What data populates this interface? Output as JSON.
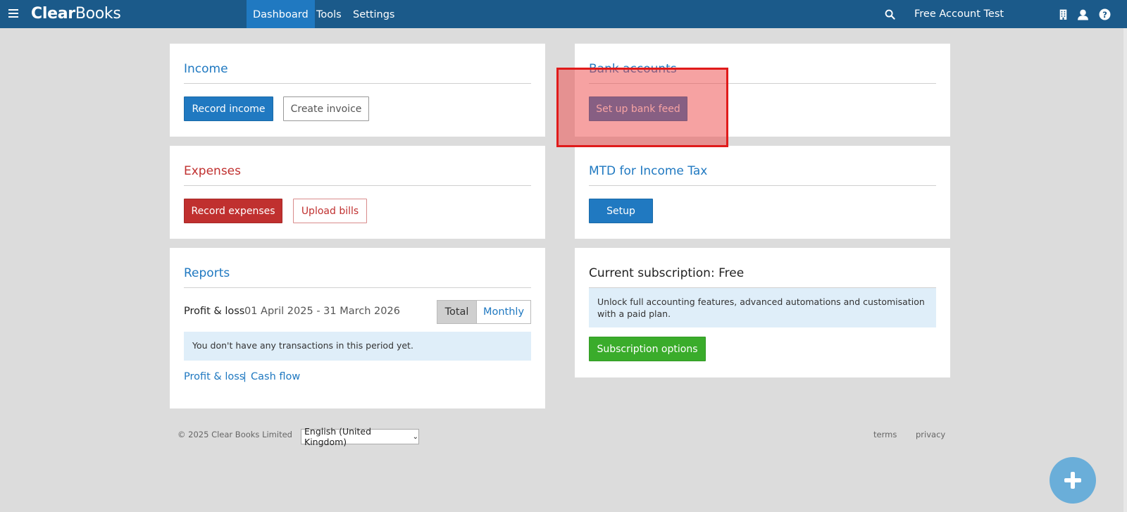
{
  "header": {
    "logo_part1": "Clear",
    "logo_part2": "Books",
    "nav": [
      {
        "label": "Dashboard",
        "active": true
      },
      {
        "label": "Tools",
        "active": false
      },
      {
        "label": "Settings",
        "active": false
      }
    ],
    "account_name": "Free Account Test",
    "icons": [
      "menu-icon",
      "search-icon",
      "building-icon",
      "user-icon",
      "help-icon"
    ]
  },
  "income": {
    "title": "Income",
    "primary_button": "Record income",
    "secondary_button": "Create invoice"
  },
  "bank": {
    "title": "Bank accounts",
    "button": "Set up bank feed"
  },
  "expenses": {
    "title": "Expenses",
    "primary_button": "Record expenses",
    "secondary_button": "Upload bills"
  },
  "mtd": {
    "title": "MTD for Income Tax",
    "button": "Setup"
  },
  "reports": {
    "title": "Reports",
    "pl_label": "Profit & loss",
    "pl_range": "01 April 2025 - 31 March 2026",
    "toggle_total": "Total",
    "toggle_monthly": "Monthly",
    "empty_message": "You don't have any transactions in this period yet.",
    "link_pl": "Profit & loss",
    "separator": "|",
    "link_cashflow": "Cash flow"
  },
  "subscription": {
    "title": "Current subscription: Free",
    "message": "Unlock full accounting features, advanced automations and customisation with a paid plan.",
    "button": "Subscription options"
  },
  "footer": {
    "copyright": "© 2025 Clear Books Limited",
    "language": "English (United Kingdom)",
    "terms": "terms",
    "privacy": "privacy"
  },
  "colors": {
    "header_bg": "#1b5a8a",
    "primary": "#2079c1",
    "danger": "#c0302f",
    "success": "#3aac2b",
    "highlight": "#e01b1b"
  }
}
